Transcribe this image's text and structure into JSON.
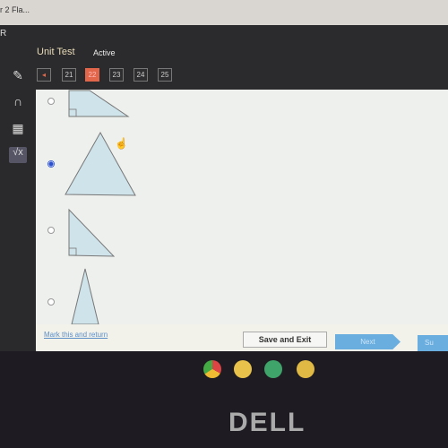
{
  "browser": {
    "tab_title": "r 2 Fla..."
  },
  "header": {
    "brand": "R",
    "title": "Unit Test",
    "status": "Active",
    "question_nav": {
      "prev_icon": "chevron-left-icon",
      "pages": [
        "21",
        "22",
        "23",
        "24",
        "25"
      ],
      "current": "22"
    }
  },
  "sidebar": {
    "tools": [
      "pencil-icon",
      "headphones-icon",
      "calculator-icon",
      "square-root-icon"
    ]
  },
  "question": {
    "options": [
      {
        "shape": "right-triangle-marked",
        "selected": false
      },
      {
        "shape": "triangle-marked",
        "selected": true
      },
      {
        "shape": "right-triangle",
        "selected": false
      },
      {
        "shape": "isosceles-triangle",
        "selected": false
      }
    ]
  },
  "footer": {
    "mark_label": "Mark this and return",
    "save_label": "Save and Exit",
    "next_label": "Next",
    "submit_label": "Su"
  },
  "taskbar": {
    "apps": [
      "chrome-icon",
      "docs-icon",
      "sheets-icon",
      "slides-icon"
    ]
  },
  "device": {
    "logo": "DELL"
  },
  "colors": {
    "current_page": "#e2674a",
    "primary_button": "#6aaee0",
    "selected_radio": "#2a4fd0"
  }
}
